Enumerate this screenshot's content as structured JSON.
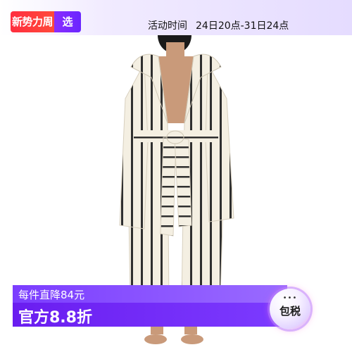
{
  "header": {
    "brand_left": "新势力周",
    "brand_right": "选",
    "activity_label": "活动时间",
    "activity_time": "24日20点-31日24点"
  },
  "promo": {
    "discount_text": "每件直降84元",
    "price_text": "官方8.8折",
    "tax_badge_dots": "•••",
    "tax_badge_label": "包税"
  },
  "colors": {
    "brand_red": "#ff2e3f",
    "brand_purple": "#7b3dff",
    "robe_cream": "#f4efe2",
    "robe_stripe": "#2f2f2f"
  },
  "product": {
    "image": "striped-hooded-bathrobe"
  }
}
